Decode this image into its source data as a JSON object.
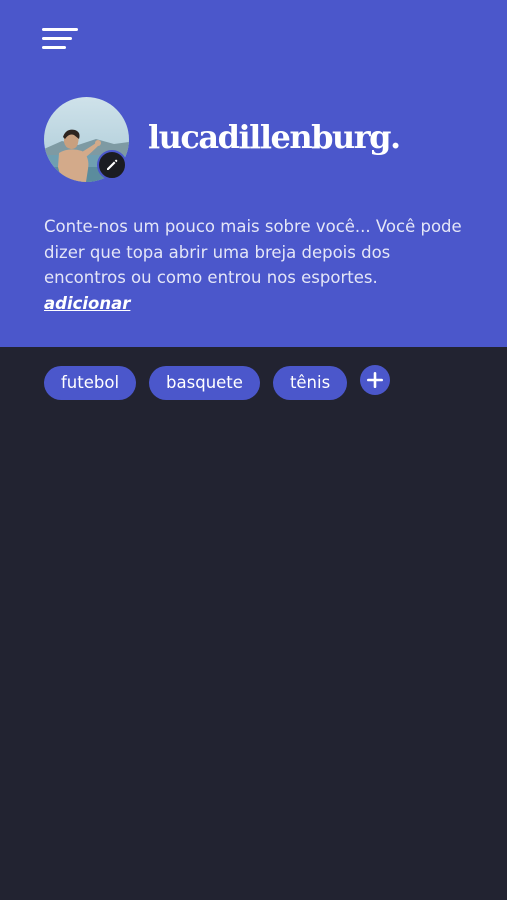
{
  "header": {
    "menu_icon": "hamburger-menu-icon",
    "username": "lucadillenburg.",
    "bio": "Conte-nos um pouco mais sobre você... Você pode dizer que topa abrir uma breja depois dos encontros ou como entrou nos esportes.",
    "add_link": "adicionar",
    "edit_icon": "pencil-icon"
  },
  "tags": [
    {
      "label": "futebol"
    },
    {
      "label": "basquete"
    },
    {
      "label": "tênis"
    }
  ],
  "add_tag_icon": "plus-icon",
  "colors": {
    "header_bg": "#4b57cb",
    "page_bg": "#222331",
    "tag_bg": "#4b57cb",
    "text": "#ffffff"
  }
}
